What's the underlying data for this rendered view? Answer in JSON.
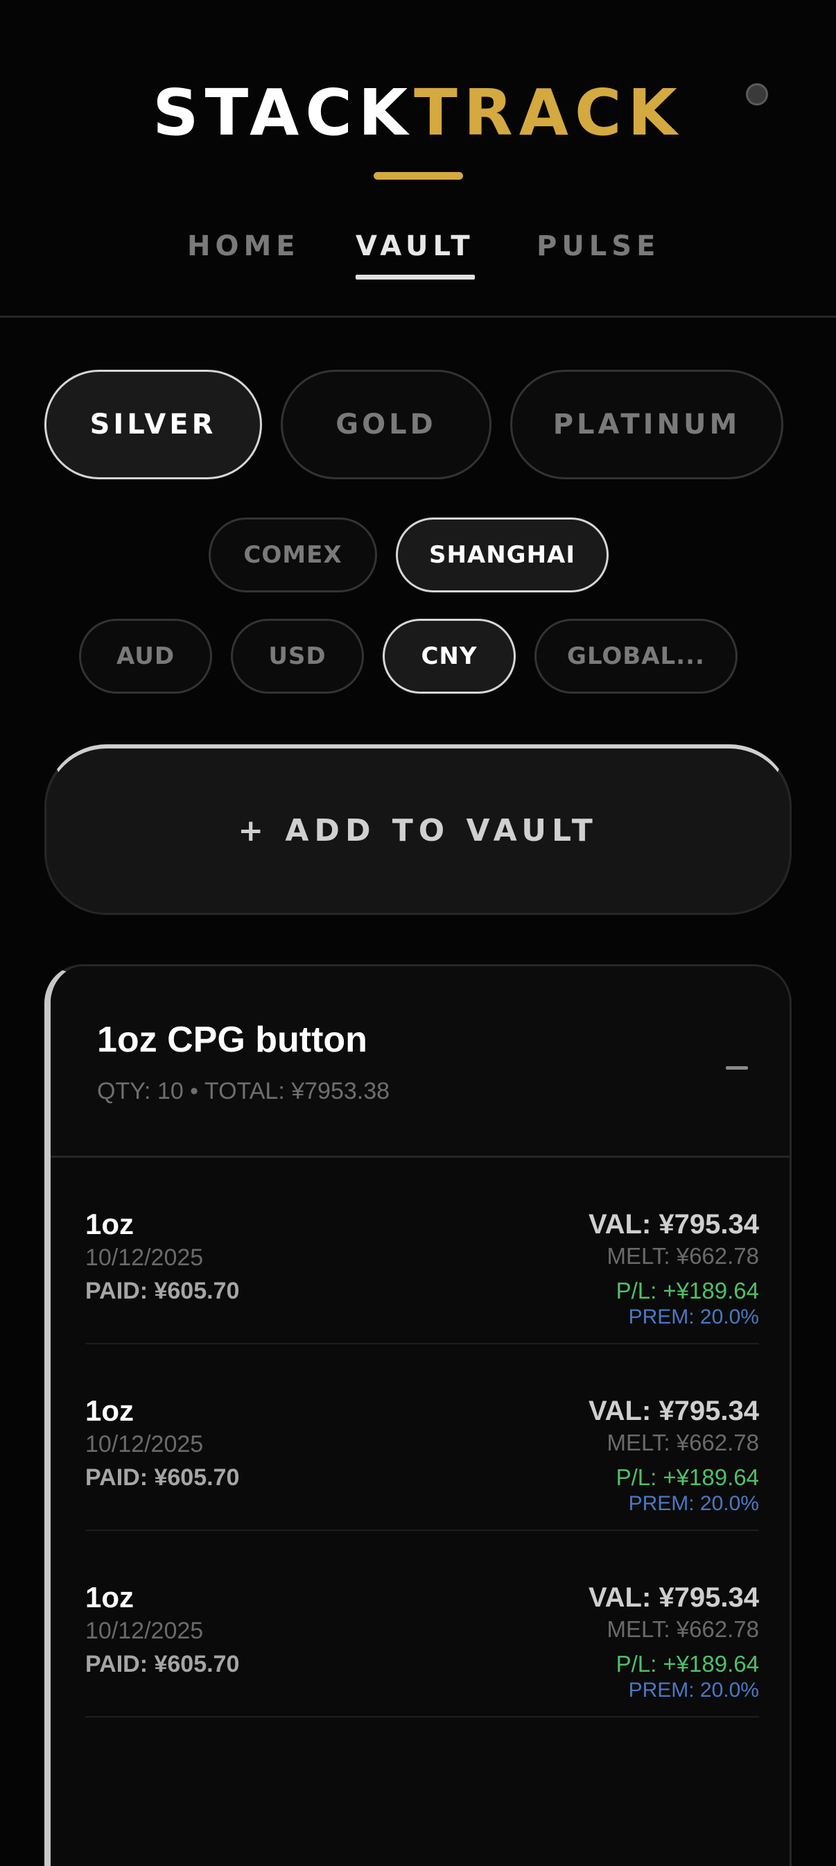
{
  "header": {
    "logo_stack": "STACK",
    "logo_track": "TRACK",
    "accent_color": "#d4a940"
  },
  "nav": {
    "tabs": [
      {
        "label": "HOME",
        "active": false
      },
      {
        "label": "VAULT",
        "active": true
      },
      {
        "label": "PULSE",
        "active": false
      }
    ]
  },
  "metals": [
    {
      "label": "SILVER",
      "active": true
    },
    {
      "label": "GOLD",
      "active": false
    },
    {
      "label": "PLATINUM",
      "active": false
    }
  ],
  "markets": [
    {
      "label": "COMEX",
      "active": false
    },
    {
      "label": "SHANGHAI",
      "active": true
    }
  ],
  "currencies": [
    {
      "label": "AUD",
      "active": false
    },
    {
      "label": "USD",
      "active": false
    },
    {
      "label": "CNY",
      "active": true
    },
    {
      "label": "GLOBAL...",
      "active": false
    }
  ],
  "add_button": {
    "label": "+ ADD TO VAULT"
  },
  "holding": {
    "title": "1oz CPG button",
    "summary": "QTY: 10 • TOTAL: ¥7953.38",
    "lots": [
      {
        "size": "1oz",
        "date": "10/12/2025",
        "paid": "PAID: ¥605.70",
        "val": "VAL: ¥795.34",
        "melt": "MELT: ¥662.78",
        "pl": "P/L: +¥189.64",
        "prem": "PREM: 20.0%"
      },
      {
        "size": "1oz",
        "date": "10/12/2025",
        "paid": "PAID: ¥605.70",
        "val": "VAL: ¥795.34",
        "melt": "MELT: ¥662.78",
        "pl": "P/L: +¥189.64",
        "prem": "PREM: 20.0%"
      },
      {
        "size": "1oz",
        "date": "10/12/2025",
        "paid": "PAID: ¥605.70",
        "val": "VAL: ¥795.34",
        "melt": "MELT: ¥662.78",
        "pl": "P/L: +¥189.64",
        "prem": "PREM: 20.0%"
      }
    ]
  },
  "colors": {
    "profit": "#4fc068",
    "premium": "#4a78c2"
  }
}
